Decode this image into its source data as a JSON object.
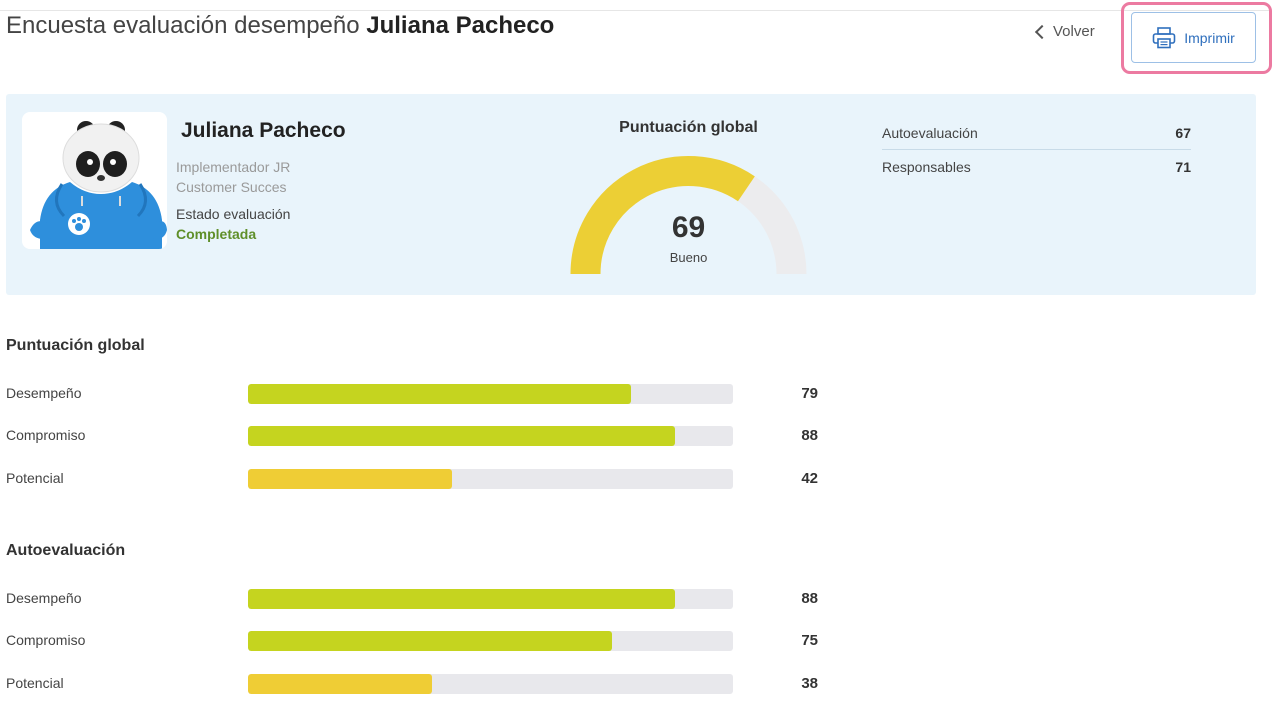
{
  "header": {
    "title_prefix": "Encuesta evaluación desempeño",
    "title_name": "Juliana Pacheco",
    "back_label": "Volver",
    "print_label": "Imprimir"
  },
  "profile": {
    "name": "Juliana Pacheco",
    "role_line1": "Implementador JR",
    "role_line2": "Customer Succes",
    "estado_label": "Estado evaluación",
    "estado_value": "Completada"
  },
  "gauge": {
    "title": "Puntuación global",
    "value": "69",
    "label": "Bueno",
    "fraction": 0.69
  },
  "summary": [
    {
      "label": "Autoevaluación",
      "value": "67"
    },
    {
      "label": "Responsables",
      "value": "71"
    }
  ],
  "sections": [
    {
      "title": "Puntuación global",
      "rows": [
        {
          "label": "Desempeño",
          "value": "79",
          "fraction": 0.79
        },
        {
          "label": "Compromiso",
          "value": "88",
          "fraction": 0.88
        },
        {
          "label": "Potencial",
          "value": "42",
          "fraction": 0.42
        }
      ]
    },
    {
      "title": "Autoevaluación",
      "rows": [
        {
          "label": "Desempeño",
          "value": "88",
          "fraction": 0.88
        },
        {
          "label": "Compromiso",
          "value": "75",
          "fraction": 0.75
        },
        {
          "label": "Potencial",
          "value": "38",
          "fraction": 0.38
        }
      ]
    }
  ],
  "colors": {
    "bar_high": "#c5d41f",
    "bar_low": "#efcd35",
    "gauge_fill": "#eccf35",
    "gauge_track": "#ececee",
    "accent": "#2f6fbd",
    "completed": "#5f8f29"
  },
  "icons": {
    "back": "chevron-left-icon",
    "print": "printer-icon",
    "avatar": "panda-avatar"
  }
}
